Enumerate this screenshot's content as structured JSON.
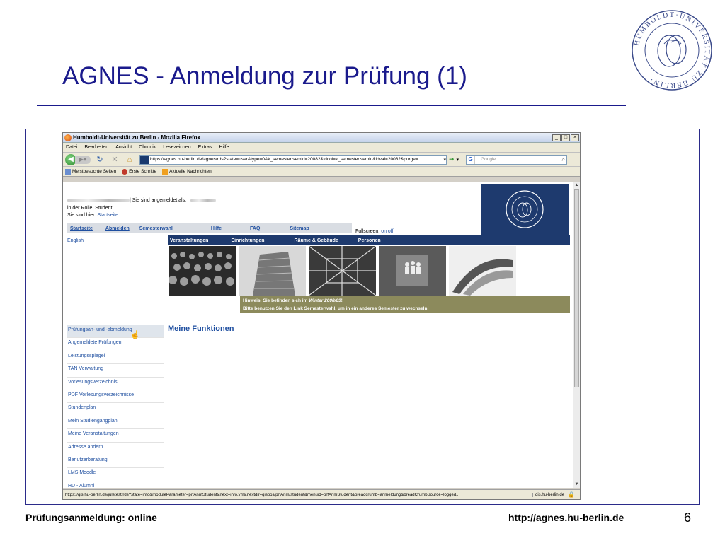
{
  "slide": {
    "title": "AGNES - Anmeldung zur Prüfung (1)",
    "footer_left": "Prüfungsanmeldung: online",
    "footer_right": "http://agnes.hu-berlin.de",
    "page_number": "6",
    "seal_text": "HUMBOLDT-UNIVERSITÄT ZU BERLIN"
  },
  "browser": {
    "window_title": "Humboldt-Universität zu Berlin - Mozilla Firefox",
    "window_buttons": [
      "_",
      "□",
      "×"
    ],
    "menu": [
      "Datei",
      "Bearbeiten",
      "Ansicht",
      "Chronik",
      "Lesezeichen",
      "Extras",
      "Hilfe"
    ],
    "url": "https://agnes.hu-berlin.de/agnes/rds?state=user&type=0&k_semester.semid=20082&idcol=k_semester.semid&idval=20082&purge=",
    "search_placeholder": "Google",
    "bookmarks": [
      "Meistbesuchte Seiten",
      "Erste Schritte",
      "Aktuelle Nachrichten"
    ],
    "status_url": "https://qis.hu-berlin.de/juletest/rds?state=info&moduleParameter=prfAnmStudent&next=info.vm&nextdir=qispos/prfAnm/student&menuid=prfAnmStudent&breadcrumb=anmeldung&breadCrumbSource=logged...",
    "status_site": "qis.hu-berlin.de"
  },
  "page": {
    "logged_in_text": "| Sie sind angemeldet als:",
    "role_text": "in der Rolle: Student",
    "here_label": "Sie sind hier:",
    "here_link": "Startseite",
    "topnav": [
      "Startseite",
      "Abmelden",
      "Semesterwahl",
      "Hilfe",
      "FAQ",
      "Sitemap"
    ],
    "fullscreen_label": "Fullscreen:",
    "fullscreen_value": "on off",
    "english_link": "English",
    "categories": [
      "Veranstaltungen",
      "Einrichtungen",
      "Räume & Gebäude",
      "Personen"
    ],
    "hint_line1_prefix": "Hinweis: Sie befinden sich im",
    "hint_line1_semester": "Winter 2008/09",
    "hint_line1_suffix": "!",
    "hint_line2": "Bitte benutzen Sie den Link Semesterwahl, um in ein anderes Semester zu wechseln!",
    "functions_title": "Meine Funktionen",
    "side_menu": [
      "Prüfungsan- und -abmeldung",
      "Angemeldete Prüfungen",
      "Leistungsspiegel",
      "TAN Verwaltung",
      "Vorlesungsverzeichnis",
      "PDF Vorlesungsverzeichnisse",
      "Stundenplan",
      "Mein Studiengangplan",
      "Meine Veranstaltungen",
      "Adresse ändern",
      "Benutzerberatung",
      "LMS Moodle",
      "HU - Alumni"
    ]
  },
  "colors": {
    "title_blue": "#1a1a8c",
    "hu_blue": "#1e3a6e",
    "link_blue": "#1f4fa0",
    "hint_olive": "#8c8a5c"
  }
}
